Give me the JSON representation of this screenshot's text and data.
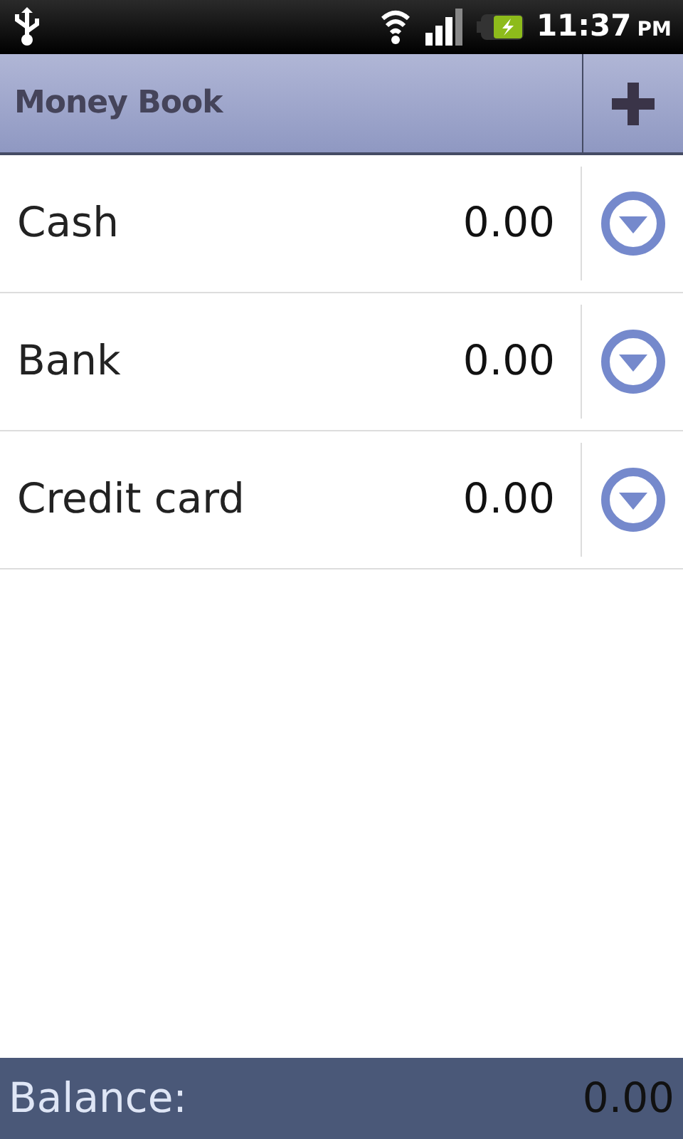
{
  "status_bar": {
    "time": "11:37",
    "ampm": "PM"
  },
  "app_bar": {
    "title": "Money Book"
  },
  "accounts": [
    {
      "name": "Cash",
      "amount": "0.00"
    },
    {
      "name": "Bank",
      "amount": "0.00"
    },
    {
      "name": "Credit card",
      "amount": "0.00"
    }
  ],
  "footer": {
    "label": "Balance:",
    "value": "0.00"
  }
}
